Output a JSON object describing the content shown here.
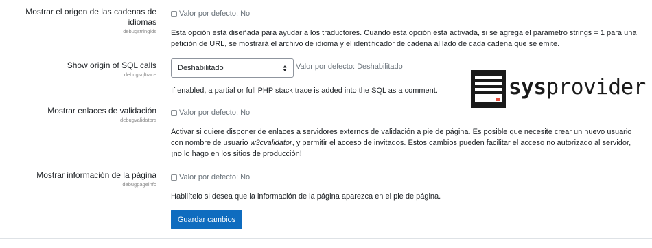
{
  "settings": [
    {
      "label_line1": "Mostrar el origen de las cadenas de",
      "label_line2": "idiomas",
      "key": "debugstringids",
      "default_text": "Valor por defecto: No",
      "desc_line1": "Esta opción está diseñada para ayudar a los traductores. Cuando esta opción está activada, si se agrega el parámetro strings = 1 para una",
      "desc_line2": "petición de URL, se mostrará el archivo de idioma y el identificador de cadena al lado de cada cadena que se emite."
    },
    {
      "label": "Show origin of SQL calls",
      "key": "debugsqltrace",
      "selected": "Deshabilitado",
      "default_text": "Valor por defecto: Deshabilitado",
      "desc": "If enabled, a partial or full PHP stack trace is added into the SQL as a comment."
    },
    {
      "label": "Mostrar enlaces de validación",
      "key": "debugvalidators",
      "default_text": "Valor por defecto: No",
      "desc_line1": "Activar si quiere disponer de enlaces a servidores externos de validación a pie de página. Es posible que necesite crear un nuevo usuario",
      "desc_line2_a": "con nombre de usuario ",
      "desc_line2_em": "w3cvalidator",
      "desc_line2_b": ", y permitir el acceso de invitados. Estos cambios pueden facilitar el acceso no autorizado al servidor,",
      "desc_line3": "¡no lo hago en los sitios de producción!"
    },
    {
      "label": "Mostrar información de la página",
      "key": "debugpageinfo",
      "default_text": "Valor por defecto: No",
      "desc": "Habilítelo si desea que la información de la página aparezca en el pie de página."
    }
  ],
  "save_button": "Guardar cambios",
  "watermark": {
    "bold": "sys",
    "regular": "provider"
  },
  "colors": {
    "primary": "#0f6cbf",
    "muted": "#6a737b",
    "logo": "#1a1a1a",
    "logo_accent": "#e74c3c"
  }
}
